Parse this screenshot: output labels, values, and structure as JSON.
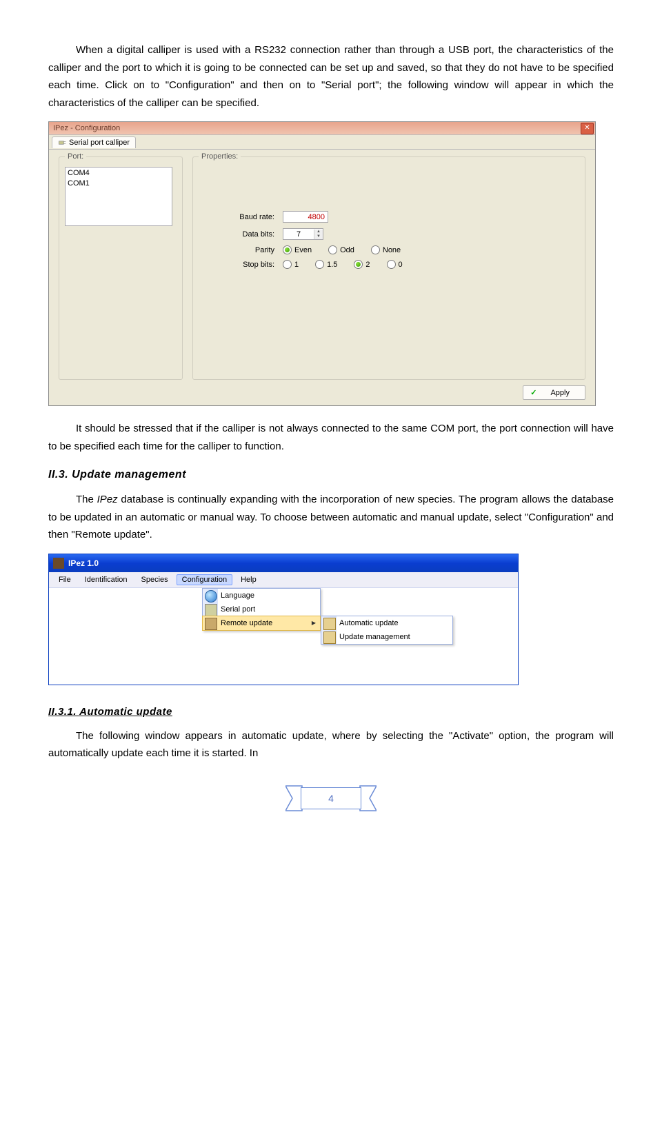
{
  "paragraphs": {
    "p1": "When a digital calliper is used with a RS232 connection rather than through a USB port, the characteristics of the calliper and the port to which it is going to be connected can be set up and saved, so that they do not have to be specified each time. Click on to \"Configuration\" and then on to \"Serial port\"; the following window will appear in which the characteristics of the calliper can be specified.",
    "p2": "It should be stressed that if the calliper is not always connected to the same COM port, the port connection will have to be specified each time for the calliper to function.",
    "p3a": "The ",
    "p3_ipez": "IPez",
    "p3b": " database is continually expanding with the incorporation of new species. The program allows the database to be updated in an automatic or manual way. To choose between automatic and manual update, select \"Configuration\" and then \"Remote update\".",
    "p4": "The following window appears in automatic update, where by selecting the \"Activate\" option, the program will automatically update each time it is started. In"
  },
  "headings": {
    "h2_update": "II.3. Update management",
    "h3_auto": "II.3.1. Automatic update"
  },
  "config_window": {
    "title": "IPez - Configuration",
    "tab": "Serial port calliper",
    "port_legend": "Port:",
    "ports": {
      "0": "COM4",
      "1": "COM1"
    },
    "props_legend": "Properties:",
    "baud_label": "Baud rate:",
    "baud_value": "4800",
    "bits_label": "Data bits:",
    "bits_value": "7",
    "parity_label": "Parity",
    "parity": {
      "even": "Even",
      "odd": "Odd",
      "none": "None"
    },
    "stop_label": "Stop bits:",
    "stop": {
      "one": "1",
      "onefive": "1.5",
      "two": "2",
      "zero": "0"
    },
    "apply": "Apply"
  },
  "menu_window": {
    "title": "IPez 1.0",
    "menubar": {
      "file": "File",
      "identification": "Identification",
      "species": "Species",
      "configuration": "Configuration",
      "help": "Help"
    },
    "dd_config": {
      "language": "Language",
      "serial": "Serial port",
      "remote": "Remote update"
    },
    "dd_remote": {
      "auto": "Automatic update",
      "mgmt": "Update management"
    }
  },
  "page_number": "4"
}
